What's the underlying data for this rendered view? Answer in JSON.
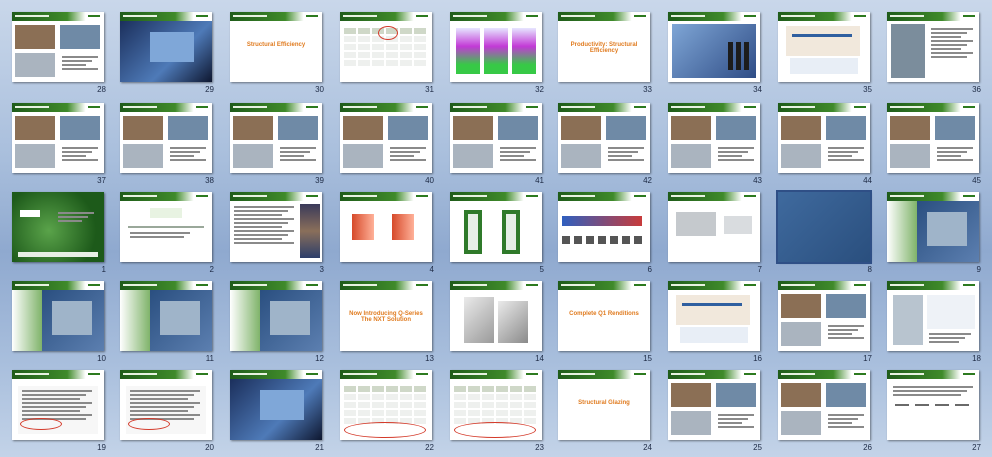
{
  "view": "slide-sorter",
  "slides": [
    {
      "number": "28",
      "kind": "photos"
    },
    {
      "number": "29",
      "kind": "dark-photo"
    },
    {
      "number": "30",
      "kind": "title-text",
      "heading": "Structural Efficiency"
    },
    {
      "number": "31",
      "kind": "table"
    },
    {
      "number": "32",
      "kind": "panels"
    },
    {
      "number": "33",
      "kind": "title-text",
      "heading": "Productivity: Structural Efficiency"
    },
    {
      "number": "34",
      "kind": "blue-photo"
    },
    {
      "number": "35",
      "kind": "diagram"
    },
    {
      "number": "36",
      "kind": "building"
    },
    {
      "number": "37",
      "kind": "photos"
    },
    {
      "number": "38",
      "kind": "photos"
    },
    {
      "number": "39",
      "kind": "photos"
    },
    {
      "number": "40",
      "kind": "photos"
    },
    {
      "number": "41",
      "kind": "photos"
    },
    {
      "number": "42",
      "kind": "photos"
    },
    {
      "number": "43",
      "kind": "photos"
    },
    {
      "number": "44",
      "kind": "photos"
    },
    {
      "number": "45",
      "kind": "photos"
    },
    {
      "number": "1",
      "kind": "green-title"
    },
    {
      "number": "2",
      "kind": "logo"
    },
    {
      "number": "3",
      "kind": "bullets"
    },
    {
      "number": "4",
      "kind": "arrows"
    },
    {
      "number": "5",
      "kind": "green-section"
    },
    {
      "number": "6",
      "kind": "gradient-arrow"
    },
    {
      "number": "7",
      "kind": "grey-product"
    },
    {
      "number": "8",
      "kind": "blank-blue"
    },
    {
      "number": "9",
      "kind": "green-blue"
    },
    {
      "number": "10",
      "kind": "green-blue"
    },
    {
      "number": "11",
      "kind": "green-blue"
    },
    {
      "number": "12",
      "kind": "green-blue"
    },
    {
      "number": "13",
      "kind": "title-text",
      "heading": "Now Introducing Q-Series\nThe NXT Solution"
    },
    {
      "number": "14",
      "kind": "window-frame"
    },
    {
      "number": "15",
      "kind": "title-text",
      "heading": "Complete Q1 Renditions"
    },
    {
      "number": "16",
      "kind": "diagram"
    },
    {
      "number": "17",
      "kind": "photos"
    },
    {
      "number": "18",
      "kind": "chart"
    },
    {
      "number": "19",
      "kind": "document"
    },
    {
      "number": "20",
      "kind": "document"
    },
    {
      "number": "21",
      "kind": "dark-photo"
    },
    {
      "number": "22",
      "kind": "table-red"
    },
    {
      "number": "23",
      "kind": "table-red"
    },
    {
      "number": "24",
      "kind": "title-text",
      "heading": "Structural Glazing"
    },
    {
      "number": "25",
      "kind": "photos"
    },
    {
      "number": "26",
      "kind": "photos"
    },
    {
      "number": "27",
      "kind": "text-list"
    }
  ],
  "selected_slide": "8",
  "colors": {
    "header_green": "#2d7a1f",
    "accent_orange": "#e07b1f",
    "background": "#a8bedc"
  }
}
